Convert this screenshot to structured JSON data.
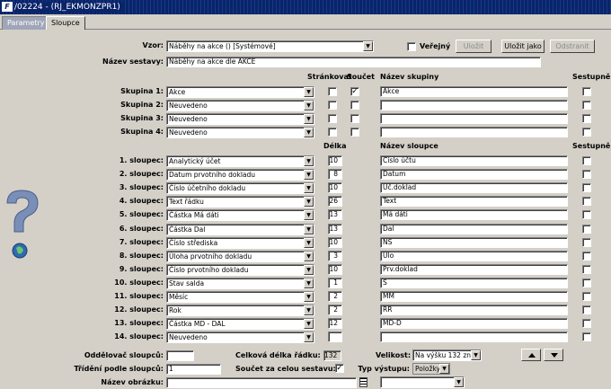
{
  "window": {
    "title": "/02224 - (RJ_EKMONZPR1)",
    "icon_text": "F"
  },
  "tabs": [
    {
      "label": "Parametry"
    },
    {
      "label": "Sloupce"
    }
  ],
  "vzor": {
    "label": "Vzor:",
    "value": "Náběhy na akce  ()  [Systémové]"
  },
  "verejny": {
    "label": "Veřejný"
  },
  "buttons": {
    "ulozit": "Uložit",
    "ulozit_jako": "Uložit jako",
    "odstranit": "Odstranit"
  },
  "nazev_sestavy": {
    "label": "Název sestavy:",
    "value": "Náběhy na akce dle AKCE"
  },
  "group_headers": {
    "strankovat": "Stránkovat",
    "soucet": "Součet",
    "nazev_skupiny": "Název skupiny",
    "sestupne": "Sestupně"
  },
  "groups": [
    {
      "label": "Skupina 1:",
      "value": "Akce",
      "strankovat": false,
      "soucet": true,
      "name": "Akce",
      "sestupne": false
    },
    {
      "label": "Skupina 2:",
      "value": "Neuvedeno",
      "strankovat": false,
      "soucet": false,
      "name": "",
      "sestupne": false
    },
    {
      "label": "Skupina 3:",
      "value": "Neuvedeno",
      "strankovat": false,
      "soucet": false,
      "name": "",
      "sestupne": false
    },
    {
      "label": "Skupina 4:",
      "value": "Neuvedeno",
      "strankovat": false,
      "soucet": false,
      "name": "",
      "sestupne": false
    }
  ],
  "col_headers": {
    "delka": "Délka",
    "nazev_sloupce": "Název sloupce",
    "sestupne": "Sestupně"
  },
  "columns": [
    {
      "label": "1. sloupec:",
      "value": "Analytický účet",
      "delka": "10",
      "name": "Číslo účtu"
    },
    {
      "label": "2. sloupec:",
      "value": "Datum prvotního dokladu",
      "delka": "8",
      "name": "Datum"
    },
    {
      "label": "3. sloupec:",
      "value": "Číslo účetního dokladu",
      "delka": "10",
      "name": "Úč.doklad"
    },
    {
      "label": "4. sloupec:",
      "value": "Text řádku",
      "delka": "26",
      "name": "Text"
    },
    {
      "label": "5. sloupec:",
      "value": "Částka Má dáti",
      "delka": "13",
      "name": "Má dáti"
    },
    {
      "label": "6. sloupec:",
      "value": "Částka Dal",
      "delka": "13",
      "name": "Dal"
    },
    {
      "label": "7. sloupec:",
      "value": "Číslo střediska",
      "delka": "10",
      "name": "NS"
    },
    {
      "label": "8. sloupec:",
      "value": "Úloha prvotního dokladu",
      "delka": "3",
      "name": "Úlo"
    },
    {
      "label": "9. sloupec:",
      "value": "Číslo prvotního dokladu",
      "delka": "10",
      "name": "Prv.doklad"
    },
    {
      "label": "10. sloupec:",
      "value": "Stav salda",
      "delka": "1",
      "name": "S"
    },
    {
      "label": "11. sloupec:",
      "value": "Měsíc",
      "delka": "2",
      "name": "MM"
    },
    {
      "label": "12. sloupec:",
      "value": "Rok",
      "delka": "2",
      "name": "RR"
    },
    {
      "label": "13. sloupec:",
      "value": "Částka MD - DAL",
      "delka": "12",
      "name": "MD-D"
    },
    {
      "label": "14. sloupec:",
      "value": "Neuvedeno",
      "delka": "",
      "name": ""
    }
  ],
  "footer": {
    "oddelovac": {
      "label": "Oddělovač sloupců:",
      "value": ""
    },
    "celkova": {
      "label": "Celková délka řádku:",
      "value": "132"
    },
    "velikost": {
      "label": "Velikost:",
      "value": "Na výšku 132 zn."
    },
    "trideni": {
      "label": "Třídění podle sloupců:",
      "value": "1"
    },
    "soucet_celou": {
      "label": "Součet za celou sestavu:",
      "checked": true
    },
    "typ_vystupu": {
      "label": "Typ výstupu:",
      "value": "Položky"
    },
    "nazev_obrazku": {
      "label": "Název obrázku:",
      "value": ""
    }
  }
}
